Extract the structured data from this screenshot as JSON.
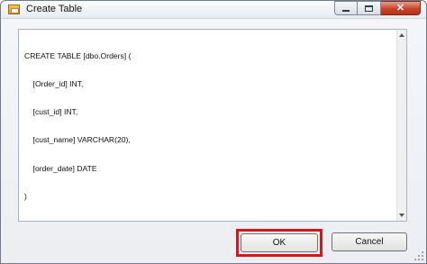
{
  "window": {
    "title": "Create Table",
    "caption": {
      "minimize_icon": "minimize-icon",
      "maximize_icon": "maximize-icon",
      "close_symbol": "✕"
    }
  },
  "editor": {
    "lines": [
      "CREATE TABLE [dbo.Orders] (",
      "    [Order_id] INT,",
      "    [cust_id] INT,",
      "    [cust_name] VARCHAR(20),",
      "    [order_date] DATE",
      ")"
    ]
  },
  "buttons": {
    "ok_label": "OK",
    "cancel_label": "Cancel"
  },
  "colors": {
    "highlight": "#d9141d",
    "close_button": "#c8432b"
  }
}
